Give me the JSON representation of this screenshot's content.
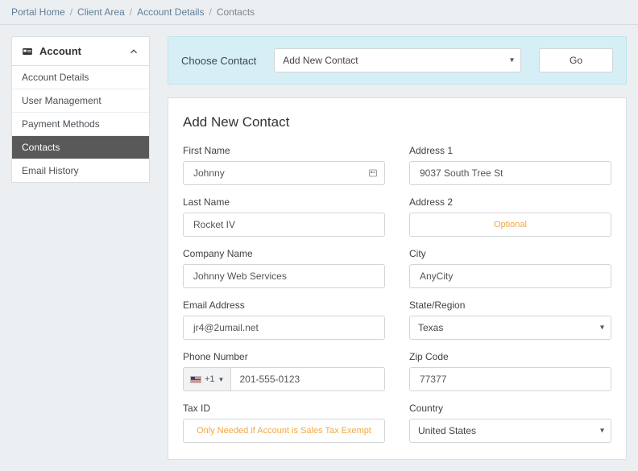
{
  "breadcrumb": {
    "items": [
      "Portal Home",
      "Client Area",
      "Account Details"
    ],
    "current": "Contacts"
  },
  "sidebar": {
    "title": "Account",
    "items": [
      {
        "label": "Account Details",
        "active": false
      },
      {
        "label": "User Management",
        "active": false
      },
      {
        "label": "Payment Methods",
        "active": false
      },
      {
        "label": "Contacts",
        "active": true
      },
      {
        "label": "Email History",
        "active": false
      }
    ]
  },
  "contactSelector": {
    "label": "Choose Contact",
    "selected": "Add New Contact",
    "go": "Go"
  },
  "form": {
    "title": "Add New Contact",
    "left": {
      "firstName": {
        "label": "First Name",
        "value": "Johnny"
      },
      "lastName": {
        "label": "Last Name",
        "value": "Rocket IV"
      },
      "company": {
        "label": "Company Name",
        "value": "Johnny Web Services"
      },
      "email": {
        "label": "Email Address",
        "value": "jr4@2umail.net"
      },
      "phone": {
        "label": "Phone Number",
        "cc": "+1",
        "value": "201-555-0123"
      },
      "taxId": {
        "label": "Tax ID",
        "placeholder": "Only Needed if Account is Sales Tax Exempt"
      }
    },
    "right": {
      "address1": {
        "label": "Address 1",
        "value": "9037 South Tree St"
      },
      "address2": {
        "label": "Address 2",
        "placeholder": "Optional"
      },
      "city": {
        "label": "City",
        "value": "AnyCity"
      },
      "state": {
        "label": "State/Region",
        "value": "Texas"
      },
      "zip": {
        "label": "Zip Code",
        "value": "77377"
      },
      "country": {
        "label": "Country",
        "value": "United States"
      }
    }
  }
}
